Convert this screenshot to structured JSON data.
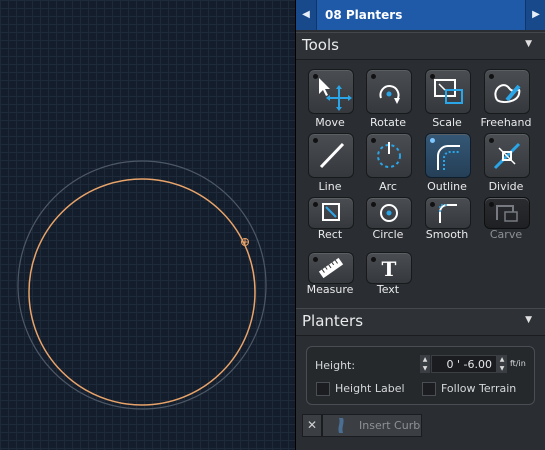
{
  "header": {
    "title": "08 Planters",
    "prev_icon": "triangle-left",
    "next_icon": "triangle-right"
  },
  "tools_section": {
    "title": "Tools",
    "items": [
      {
        "label": "Move",
        "icon": "move-icon"
      },
      {
        "label": "Rotate",
        "icon": "rotate-icon"
      },
      {
        "label": "Scale",
        "icon": "scale-icon"
      },
      {
        "label": "Freehand",
        "icon": "freehand-icon"
      },
      {
        "label": "Line",
        "icon": "line-icon"
      },
      {
        "label": "Arc",
        "icon": "arc-icon"
      },
      {
        "label": "Outline",
        "icon": "outline-icon",
        "selected": true
      },
      {
        "label": "Divide",
        "icon": "divide-icon"
      },
      {
        "label": "Rect",
        "icon": "rect-icon"
      },
      {
        "label": "Circle",
        "icon": "circle-icon"
      },
      {
        "label": "Smooth",
        "icon": "smooth-icon"
      },
      {
        "label": "Carve",
        "icon": "carve-icon",
        "disabled": true
      },
      {
        "label": "Measure",
        "icon": "measure-icon"
      },
      {
        "label": "Text",
        "icon": "text-icon"
      }
    ]
  },
  "planters_section": {
    "title": "Planters",
    "height_label": "Height:",
    "height_value": "0 ' -6.00",
    "height_unit": "ft/in",
    "height_label_checkbox": "Height Label",
    "follow_terrain_checkbox": "Follow Terrain"
  },
  "actions": {
    "delete_label": "✕",
    "insert_curb_label": "Insert Curb"
  },
  "colors": {
    "accent": "#1e5aa8",
    "selection": "#f0a868",
    "icon_blue": "#2aa6e8"
  }
}
